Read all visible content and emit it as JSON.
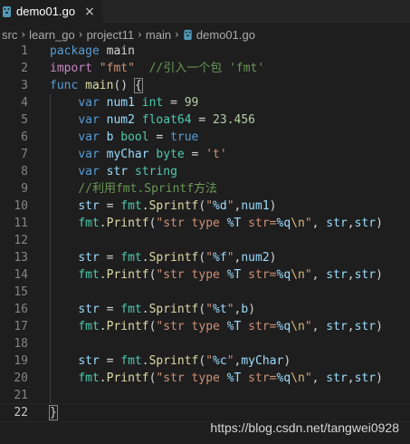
{
  "tab": {
    "label": "demo01.go",
    "close": "×"
  },
  "breadcrumb": {
    "items": [
      "src",
      "learn_go",
      "project11",
      "main",
      "demo01.go"
    ],
    "separator": "›"
  },
  "colors": {
    "keyword": "#569cd6",
    "control": "#c586c0",
    "type": "#4ec9b0",
    "function": "#dcdcaa",
    "string": "#ce9178",
    "number": "#b5cea8",
    "variable": "#9cdcfe",
    "comment": "#6a9955",
    "plain": "#d4d4d4",
    "escape": "#d7ba7d"
  },
  "code": {
    "lines": [
      {
        "n": "1",
        "tokens": [
          [
            "package",
            "keyword"
          ],
          [
            " main",
            "plain"
          ]
        ]
      },
      {
        "n": "2",
        "tokens": [
          [
            "import",
            "control"
          ],
          [
            " ",
            "plain"
          ],
          [
            "\"fmt\"",
            "string"
          ],
          [
            "  ",
            "plain"
          ],
          [
            "//引入一个包 'fmt'",
            "comment"
          ]
        ]
      },
      {
        "n": "3",
        "tokens": [
          [
            "func",
            "keyword"
          ],
          [
            " ",
            "plain"
          ],
          [
            "main",
            "function"
          ],
          [
            "() ",
            "plain"
          ],
          [
            "{",
            "plain"
          ]
        ]
      },
      {
        "n": "4",
        "tokens": [
          [
            "    ",
            "plain"
          ],
          [
            "var",
            "keyword"
          ],
          [
            " ",
            "plain"
          ],
          [
            "num1",
            "variable"
          ],
          [
            " ",
            "plain"
          ],
          [
            "int",
            "type"
          ],
          [
            " = ",
            "plain"
          ],
          [
            "99",
            "number"
          ]
        ]
      },
      {
        "n": "5",
        "tokens": [
          [
            "    ",
            "plain"
          ],
          [
            "var",
            "keyword"
          ],
          [
            " ",
            "plain"
          ],
          [
            "num2",
            "variable"
          ],
          [
            " ",
            "plain"
          ],
          [
            "float64",
            "type"
          ],
          [
            " = ",
            "plain"
          ],
          [
            "23.456",
            "number"
          ]
        ]
      },
      {
        "n": "6",
        "tokens": [
          [
            "    ",
            "plain"
          ],
          [
            "var",
            "keyword"
          ],
          [
            " ",
            "plain"
          ],
          [
            "b",
            "variable"
          ],
          [
            " ",
            "plain"
          ],
          [
            "bool",
            "type"
          ],
          [
            " = ",
            "plain"
          ],
          [
            "true",
            "keyword"
          ]
        ]
      },
      {
        "n": "7",
        "tokens": [
          [
            "    ",
            "plain"
          ],
          [
            "var",
            "keyword"
          ],
          [
            " ",
            "plain"
          ],
          [
            "myChar",
            "variable"
          ],
          [
            " ",
            "plain"
          ],
          [
            "byte",
            "type"
          ],
          [
            " = ",
            "plain"
          ],
          [
            "'t'",
            "string"
          ]
        ]
      },
      {
        "n": "8",
        "tokens": [
          [
            "    ",
            "plain"
          ],
          [
            "var",
            "keyword"
          ],
          [
            " ",
            "plain"
          ],
          [
            "str",
            "variable"
          ],
          [
            " ",
            "plain"
          ],
          [
            "string",
            "type"
          ]
        ]
      },
      {
        "n": "9",
        "tokens": [
          [
            "    ",
            "plain"
          ],
          [
            "//利用fmt.Sprintf方法",
            "comment"
          ]
        ]
      },
      {
        "n": "10",
        "tokens": [
          [
            "    ",
            "plain"
          ],
          [
            "str",
            "variable"
          ],
          [
            " = ",
            "plain"
          ],
          [
            "fmt",
            "type"
          ],
          [
            ".",
            "plain"
          ],
          [
            "Sprintf",
            "function"
          ],
          [
            "(",
            "plain"
          ],
          [
            "\"",
            "string"
          ],
          [
            "%d",
            "variable"
          ],
          [
            "\"",
            "string"
          ],
          [
            ",",
            "plain"
          ],
          [
            "num1",
            "variable"
          ],
          [
            ")",
            "plain"
          ]
        ]
      },
      {
        "n": "11",
        "tokens": [
          [
            "    ",
            "plain"
          ],
          [
            "fmt",
            "type"
          ],
          [
            ".",
            "plain"
          ],
          [
            "Printf",
            "function"
          ],
          [
            "(",
            "plain"
          ],
          [
            "\"str type ",
            "string"
          ],
          [
            "%T",
            "variable"
          ],
          [
            " str=",
            "string"
          ],
          [
            "%q",
            "variable"
          ],
          [
            "\\n",
            "escape"
          ],
          [
            "\"",
            "string"
          ],
          [
            ", ",
            "plain"
          ],
          [
            "str",
            "variable"
          ],
          [
            ",",
            "plain"
          ],
          [
            "str",
            "variable"
          ],
          [
            ")",
            "plain"
          ]
        ]
      },
      {
        "n": "12",
        "tokens": []
      },
      {
        "n": "13",
        "tokens": [
          [
            "    ",
            "plain"
          ],
          [
            "str",
            "variable"
          ],
          [
            " = ",
            "plain"
          ],
          [
            "fmt",
            "type"
          ],
          [
            ".",
            "plain"
          ],
          [
            "Sprintf",
            "function"
          ],
          [
            "(",
            "plain"
          ],
          [
            "\"",
            "string"
          ],
          [
            "%f",
            "variable"
          ],
          [
            "\"",
            "string"
          ],
          [
            ",",
            "plain"
          ],
          [
            "num2",
            "variable"
          ],
          [
            ")",
            "plain"
          ]
        ]
      },
      {
        "n": "14",
        "tokens": [
          [
            "    ",
            "plain"
          ],
          [
            "fmt",
            "type"
          ],
          [
            ".",
            "plain"
          ],
          [
            "Printf",
            "function"
          ],
          [
            "(",
            "plain"
          ],
          [
            "\"str type ",
            "string"
          ],
          [
            "%T",
            "variable"
          ],
          [
            " str=",
            "string"
          ],
          [
            "%q",
            "variable"
          ],
          [
            "\\n",
            "escape"
          ],
          [
            "\"",
            "string"
          ],
          [
            ", ",
            "plain"
          ],
          [
            "str",
            "variable"
          ],
          [
            ",",
            "plain"
          ],
          [
            "str",
            "variable"
          ],
          [
            ")",
            "plain"
          ]
        ]
      },
      {
        "n": "15",
        "tokens": []
      },
      {
        "n": "16",
        "tokens": [
          [
            "    ",
            "plain"
          ],
          [
            "str",
            "variable"
          ],
          [
            " = ",
            "plain"
          ],
          [
            "fmt",
            "type"
          ],
          [
            ".",
            "plain"
          ],
          [
            "Sprintf",
            "function"
          ],
          [
            "(",
            "plain"
          ],
          [
            "\"",
            "string"
          ],
          [
            "%t",
            "variable"
          ],
          [
            "\"",
            "string"
          ],
          [
            ",",
            "plain"
          ],
          [
            "b",
            "variable"
          ],
          [
            ")",
            "plain"
          ]
        ]
      },
      {
        "n": "17",
        "tokens": [
          [
            "    ",
            "plain"
          ],
          [
            "fmt",
            "type"
          ],
          [
            ".",
            "plain"
          ],
          [
            "Printf",
            "function"
          ],
          [
            "(",
            "plain"
          ],
          [
            "\"str type ",
            "string"
          ],
          [
            "%T",
            "variable"
          ],
          [
            " str=",
            "string"
          ],
          [
            "%q",
            "variable"
          ],
          [
            "\\n",
            "escape"
          ],
          [
            "\"",
            "string"
          ],
          [
            ", ",
            "plain"
          ],
          [
            "str",
            "variable"
          ],
          [
            ",",
            "plain"
          ],
          [
            "str",
            "variable"
          ],
          [
            ")",
            "plain"
          ]
        ]
      },
      {
        "n": "18",
        "tokens": []
      },
      {
        "n": "19",
        "tokens": [
          [
            "    ",
            "plain"
          ],
          [
            "str",
            "variable"
          ],
          [
            " = ",
            "plain"
          ],
          [
            "fmt",
            "type"
          ],
          [
            ".",
            "plain"
          ],
          [
            "Sprintf",
            "function"
          ],
          [
            "(",
            "plain"
          ],
          [
            "\"",
            "string"
          ],
          [
            "%c",
            "variable"
          ],
          [
            "\"",
            "string"
          ],
          [
            ",",
            "plain"
          ],
          [
            "myChar",
            "variable"
          ],
          [
            ")",
            "plain"
          ]
        ]
      },
      {
        "n": "20",
        "tokens": [
          [
            "    ",
            "plain"
          ],
          [
            "fmt",
            "type"
          ],
          [
            ".",
            "plain"
          ],
          [
            "Printf",
            "function"
          ],
          [
            "(",
            "plain"
          ],
          [
            "\"str type ",
            "string"
          ],
          [
            "%T",
            "variable"
          ],
          [
            " str=",
            "string"
          ],
          [
            "%q",
            "variable"
          ],
          [
            "\\n",
            "escape"
          ],
          [
            "\"",
            "string"
          ],
          [
            ", ",
            "plain"
          ],
          [
            "str",
            "variable"
          ],
          [
            ",",
            "plain"
          ],
          [
            "str",
            "variable"
          ],
          [
            ")",
            "plain"
          ]
        ]
      },
      {
        "n": "21",
        "tokens": []
      },
      {
        "n": "22",
        "tokens": [
          [
            "}",
            "plain"
          ]
        ],
        "current": true
      }
    ]
  },
  "watermark": "https://blog.csdn.net/tangwei0928"
}
